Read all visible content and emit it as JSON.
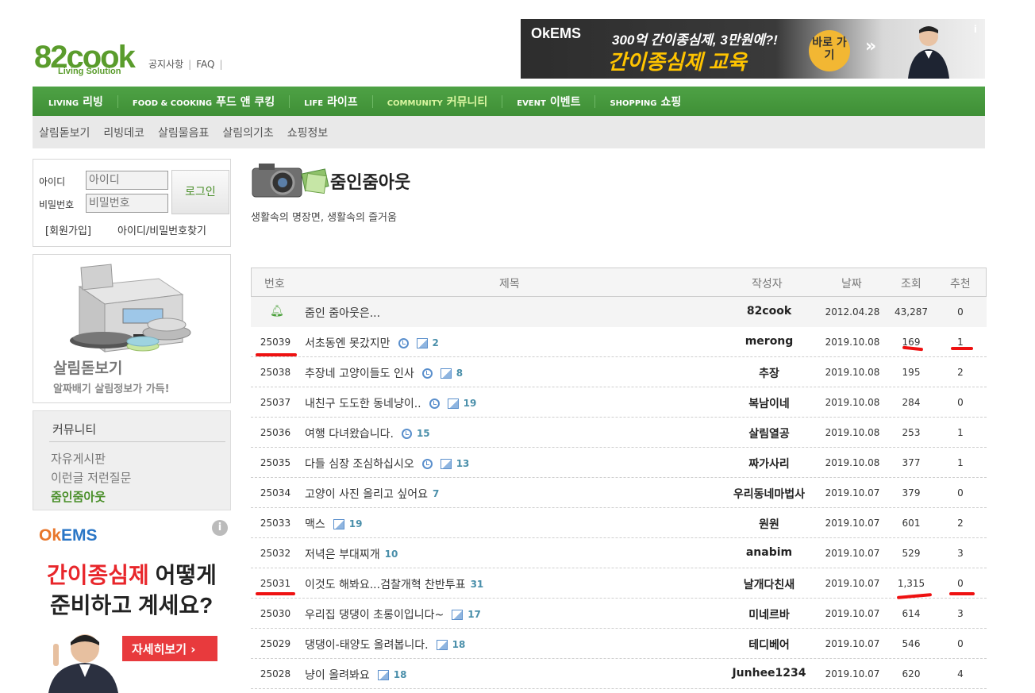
{
  "header": {
    "logo_text": "82cook",
    "logo_sub": "Living Solution",
    "links": [
      "공지사항",
      "FAQ"
    ]
  },
  "banner": {
    "brand": "OkEMS",
    "line1": "300억 간이종심제, 3만원에?!",
    "line2": "간이종심제 교육",
    "button": "바로 가기",
    "arrow": "»",
    "info": "i"
  },
  "nav": {
    "items": [
      {
        "en": "LIVING",
        "ko": "리빙"
      },
      {
        "en": "FOOD & COOKING",
        "ko": "푸드 앤 쿠킹"
      },
      {
        "en": "LIFE",
        "ko": "라이프"
      },
      {
        "en": "COMMUNITY",
        "ko": "커뮤니티"
      },
      {
        "en": "EVENT",
        "ko": "이벤트"
      },
      {
        "en": "SHOPPING",
        "ko": "쇼핑"
      }
    ],
    "sub_items": [
      "살림돋보기",
      "리빙데코",
      "살림물음표",
      "살림의기초",
      "쇼핑정보"
    ]
  },
  "login": {
    "id_label": "아이디",
    "id_placeholder": "아이디",
    "pw_label": "비밀번호",
    "pw_placeholder": "비밀번호",
    "button": "로그인",
    "signup": "[회원가입]",
    "find": "아이디/비밀번호찾기"
  },
  "promo": {
    "title": "살림돋보기",
    "subtitle": "알짜배기 살림정보가 가득!"
  },
  "community": {
    "title": "커뮤니티",
    "items": [
      "자유게시판",
      "이런글 저런질문",
      "줌인줌아웃"
    ]
  },
  "side_ad": {
    "brand_ok": "Ok",
    "brand_ems": "EMS",
    "line1_red": "간이종심제",
    "line1_rest": " 어떻게",
    "line2": "준비하고 계세요?",
    "button": "자세히보기 ›",
    "info": "i"
  },
  "page": {
    "title": "줌인줌아웃",
    "description": "생활속의 명장면, 생활속의 즐거움"
  },
  "board": {
    "columns": [
      "번호",
      "제목",
      "작성자",
      "날짜",
      "조회",
      "추천"
    ],
    "notice": {
      "title": "줌인 줌아웃은...",
      "author": "82cook",
      "date": "2012.04.28",
      "views": "43,287",
      "rec": "0"
    },
    "rows": [
      {
        "no": "25039",
        "title": "서초동엔 못갔지만",
        "clock": true,
        "img": true,
        "count": "2",
        "author": "merong",
        "date": "2019.10.08",
        "views": "169",
        "rec": "1"
      },
      {
        "no": "25038",
        "title": "추장네 고양이들도 인사",
        "clock": true,
        "img": true,
        "count": "8",
        "author": "추장",
        "date": "2019.10.08",
        "views": "195",
        "rec": "2"
      },
      {
        "no": "25037",
        "title": "내친구 도도한 동네냥이..",
        "clock": true,
        "img": true,
        "count": "19",
        "author": "복남이네",
        "date": "2019.10.08",
        "views": "284",
        "rec": "0"
      },
      {
        "no": "25036",
        "title": "여행 다녀왔습니다.",
        "clock": true,
        "img": false,
        "count": "15",
        "author": "살림열공",
        "date": "2019.10.08",
        "views": "253",
        "rec": "1"
      },
      {
        "no": "25035",
        "title": "다들 심장 조심하십시오",
        "clock": true,
        "img": true,
        "count": "13",
        "author": "짜가사리",
        "date": "2019.10.08",
        "views": "377",
        "rec": "1"
      },
      {
        "no": "25034",
        "title": "고양이 사진 올리고 싶어요",
        "clock": false,
        "img": false,
        "count": "7",
        "author": "우리동네마법사",
        "date": "2019.10.07",
        "views": "379",
        "rec": "0"
      },
      {
        "no": "25033",
        "title": "맥스",
        "clock": false,
        "img": true,
        "count": "19",
        "author": "원원",
        "date": "2019.10.07",
        "views": "601",
        "rec": "2"
      },
      {
        "no": "25032",
        "title": "저녁은 부대찌개",
        "clock": false,
        "img": false,
        "count": "10",
        "author": "anabim",
        "date": "2019.10.07",
        "views": "529",
        "rec": "3"
      },
      {
        "no": "25031",
        "title": "이것도 해봐요...검찰개혁 찬반투표",
        "clock": false,
        "img": false,
        "count": "31",
        "author": "날개다친새",
        "date": "2019.10.07",
        "views": "1,315",
        "rec": "0"
      },
      {
        "no": "25030",
        "title": "우리집 댕댕이 초롱이입니다~",
        "clock": false,
        "img": true,
        "count": "17",
        "author": "미네르바",
        "date": "2019.10.07",
        "views": "614",
        "rec": "3"
      },
      {
        "no": "25029",
        "title": "댕댕이-태양도 올려봅니다.",
        "clock": false,
        "img": true,
        "count": "18",
        "author": "테디베어",
        "date": "2019.10.07",
        "views": "546",
        "rec": "0"
      },
      {
        "no": "25028",
        "title": "냥이 올려봐요",
        "clock": false,
        "img": true,
        "count": "18",
        "author": "Junhee1234",
        "date": "2019.10.07",
        "views": "620",
        "rec": "4"
      }
    ]
  },
  "colors": {
    "brand_green": "#4a9f3c",
    "accent_red": "#ee1111"
  }
}
